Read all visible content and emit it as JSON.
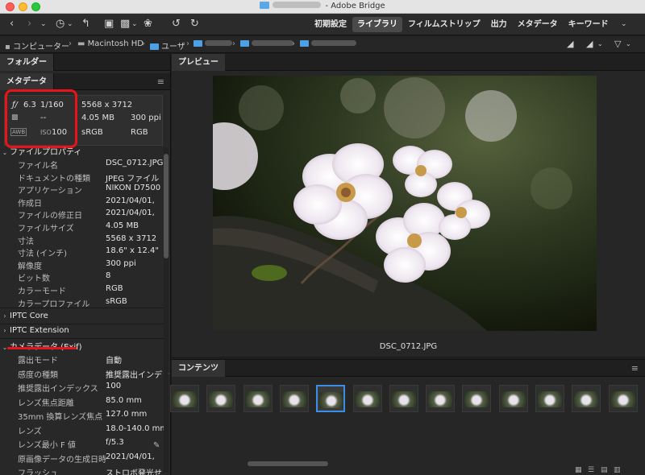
{
  "window": {
    "app_title": "Adobe Bridge"
  },
  "toolbar": {
    "workspaces": [
      "初期設定",
      "ライブラリ",
      "フィルムストリップ",
      "出力",
      "メタデータ",
      "キーワード"
    ],
    "active_workspace": "ライブラリ"
  },
  "path": {
    "computer": "コンピューター",
    "disk": "Macintosh HD",
    "users": "ユーザ"
  },
  "panels": {
    "folders": "フォルダー",
    "metadata": "メタデータ",
    "preview": "プレビュー",
    "content": "コンテンツ"
  },
  "summary": {
    "aperture": "6.3",
    "shutter": "1/160",
    "focus": "--",
    "iso_label": "ISO",
    "iso": "100",
    "dimensions": "5568 x 3712",
    "size": "4.05 MB",
    "resolution": "300 ppi",
    "profile": "sRGB",
    "mode": "RGB"
  },
  "file_properties": {
    "title": "ファイルプロパティ",
    "rows": [
      {
        "k": "ファイル名",
        "v": "DSC_0712.JPG"
      },
      {
        "k": "ドキュメントの種類",
        "v": "JPEG ファイル"
      },
      {
        "k": "アプリケーション",
        "v": "NIKON D7500"
      },
      {
        "k": "作成日",
        "v": "2021/04/01,"
      },
      {
        "k": "ファイルの修正日",
        "v": "2021/04/01,"
      },
      {
        "k": "ファイルサイズ",
        "v": "4.05 MB"
      },
      {
        "k": "寸法",
        "v": "5568 x 3712"
      },
      {
        "k": "寸法 (インチ)",
        "v": "18.6\" x 12.4\""
      },
      {
        "k": "解像度",
        "v": "300 ppi"
      },
      {
        "k": "ビット数",
        "v": "8"
      },
      {
        "k": "カラーモード",
        "v": "RGB"
      },
      {
        "k": "カラープロファイル",
        "v": "sRGB"
      }
    ]
  },
  "iptc_core": "IPTC Core",
  "iptc_ext": "IPTC Extension",
  "camera": {
    "title": "カメラデータ (Exif)",
    "rows": [
      {
        "k": "露出モード",
        "v": "自動"
      },
      {
        "k": "感度の種類",
        "v": "推奨露出インデッ"
      },
      {
        "k": "推奨露出インデックス",
        "v": "100"
      },
      {
        "k": "レンズ焦点距離",
        "v": "85.0 mm"
      },
      {
        "k": "35mm 換算レンズ焦点",
        "v": "127.0 mm"
      },
      {
        "k": "レンズ",
        "v": "18.0-140.0 mm"
      },
      {
        "k": "レンズ最小 F 値",
        "v": "f/5.3"
      },
      {
        "k": "原画像データの生成日時",
        "v": "2021/04/01,"
      },
      {
        "k": "フラッシュ",
        "v": "ストロボ発光せ"
      }
    ]
  },
  "preview": {
    "filename": "DSC_0712.JPG"
  }
}
